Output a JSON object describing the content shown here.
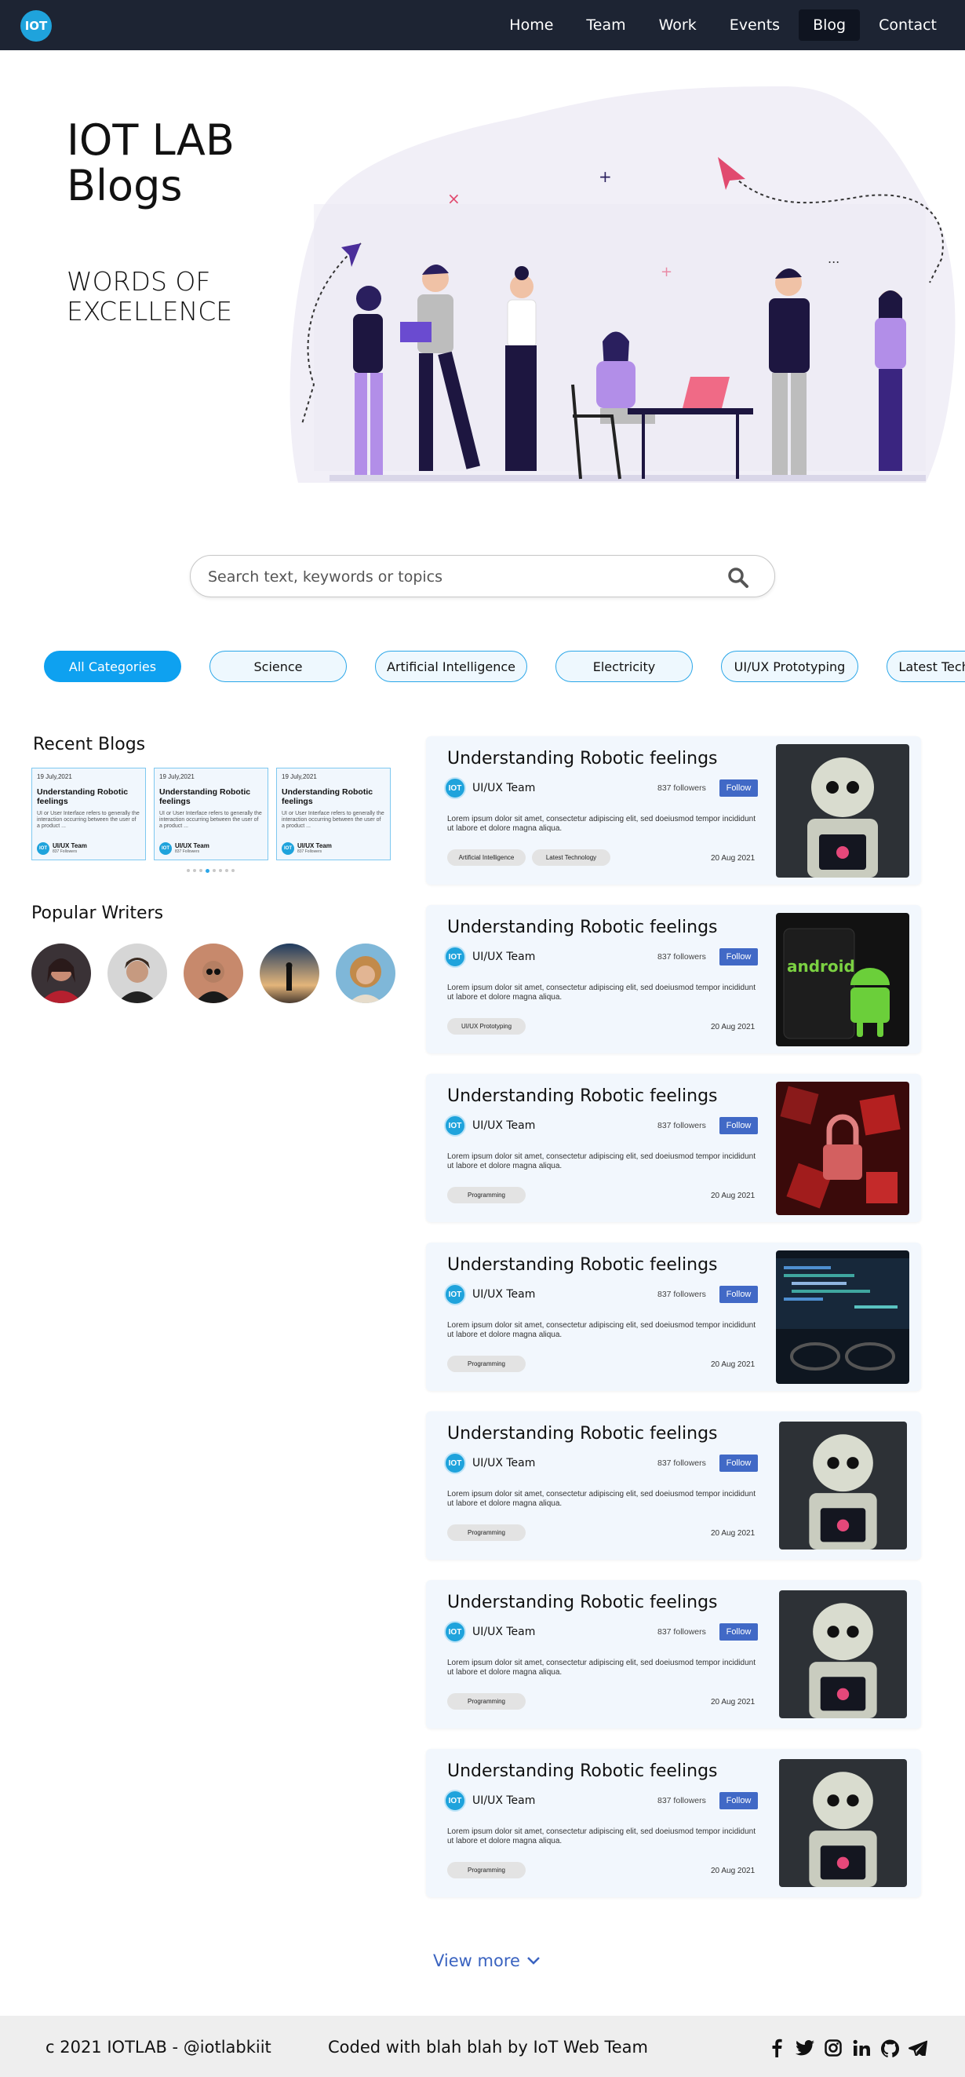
{
  "nav": {
    "logo_text": "IOT",
    "links": [
      "Home",
      "Team",
      "Work",
      "Events",
      "Blog",
      "Contact"
    ],
    "active": "Blog"
  },
  "hero": {
    "title_line1": "IOT LAB",
    "title_line2": "Blogs",
    "subtitle_line1": "WORDS OF",
    "subtitle_line2": "EXCELLENCE"
  },
  "search": {
    "placeholder": "Search text, keywords or topics"
  },
  "categories": [
    "All Categories",
    "Science",
    "Artificial Intelligence",
    "Electricity",
    "UI/UX Prototyping",
    "Latest Technology"
  ],
  "recent": {
    "title": "Recent Blogs",
    "cards": [
      {
        "date": "19 July,2021",
        "title": "Understanding Robotic feelings",
        "text": "UI or User Interface refers to generally the interaction occurring between the user of a product ...",
        "author": "UI/UX Team",
        "followers": "837 Followers"
      },
      {
        "date": "19 July,2021",
        "title": "Understanding Robotic feelings",
        "text": "UI or User Interface refers to generally the interaction occurring between the user of a product ...",
        "author": "UI/UX Team",
        "followers": "837 Followers"
      },
      {
        "date": "19 July,2021",
        "title": "Understanding Robotic feelings",
        "text": "UI or User Interface refers to generally the interaction occurring between the user of a product ...",
        "author": "UI/UX Team",
        "followers": "837 Followers"
      }
    ]
  },
  "writers": {
    "title": "Popular Writers"
  },
  "blogs": [
    {
      "title": "Understanding Robotic feelings",
      "author": "UI/UX Team",
      "followers": "837 followers",
      "follow": "Follow",
      "text": "Lorem ipsum dolor sit amet, consectetur adipiscing elit, sed doeiusmod tempor incididunt ut labore et dolore magna aliqua.",
      "tags": [
        "Artificial Intelligence",
        "Latest Technology"
      ],
      "date": "20 Aug 2021",
      "image": "robot"
    },
    {
      "title": "Understanding Robotic feelings",
      "author": "UI/UX Team",
      "followers": "837 followers",
      "follow": "Follow",
      "text": "Lorem ipsum dolor sit amet, consectetur adipiscing elit, sed doeiusmod tempor incididunt ut labore et dolore magna aliqua.",
      "tags": [
        "UI/UX Prototyping"
      ],
      "date": "20 Aug 2021",
      "image": "android"
    },
    {
      "title": "Understanding Robotic feelings",
      "author": "UI/UX Team",
      "followers": "837 followers",
      "follow": "Follow",
      "text": "Lorem ipsum dolor sit amet, consectetur adipiscing elit, sed doeiusmod tempor incididunt ut labore et dolore magna aliqua.",
      "tags": [
        "Programming"
      ],
      "date": "20 Aug 2021",
      "image": "lock"
    },
    {
      "title": "Understanding Robotic feelings",
      "author": "UI/UX Team",
      "followers": "837 followers",
      "follow": "Follow",
      "text": "Lorem ipsum dolor sit amet, consectetur adipiscing elit, sed doeiusmod tempor incididunt ut labore et dolore magna aliqua.",
      "tags": [
        "Programming"
      ],
      "date": "20 Aug 2021",
      "image": "code"
    },
    {
      "title": "Understanding Robotic feelings",
      "author": "UI/UX Team",
      "followers": "837 followers",
      "follow": "Follow",
      "text": "Lorem ipsum dolor sit amet, consectetur adipiscing elit, sed doeiusmod tempor incididunt ut labore et dolore magna aliqua.",
      "tags": [
        "Programming"
      ],
      "date": "20 Aug 2021",
      "image": "robot"
    },
    {
      "title": "Understanding Robotic feelings",
      "author": "UI/UX Team",
      "followers": "837 followers",
      "follow": "Follow",
      "text": "Lorem ipsum dolor sit amet, consectetur adipiscing elit, sed doeiusmod tempor incididunt ut labore et dolore magna aliqua.",
      "tags": [
        "Programming"
      ],
      "date": "20 Aug 2021",
      "image": "robot"
    },
    {
      "title": "Understanding Robotic feelings",
      "author": "UI/UX Team",
      "followers": "837 followers",
      "follow": "Follow",
      "text": "Lorem ipsum dolor sit amet, consectetur adipiscing elit, sed doeiusmod tempor incididunt ut labore et dolore magna aliqua.",
      "tags": [
        "Programming"
      ],
      "date": "20 Aug 2021",
      "image": "robot"
    }
  ],
  "view_more": "View more",
  "footer": {
    "copyright": "c 2021 IOTLAB - @iotlabkiit",
    "coded": "Coded with blah blah by IoT Web Team",
    "social_icons": [
      "facebook-icon",
      "twitter-icon",
      "instagram-icon",
      "linkedin-icon",
      "github-icon",
      "telegram-icon"
    ]
  },
  "colors": {
    "nav_bg": "#1d2433",
    "accent": "#0ea1f0",
    "follow": "#4169c6",
    "card_bg": "#f2f7fd"
  }
}
